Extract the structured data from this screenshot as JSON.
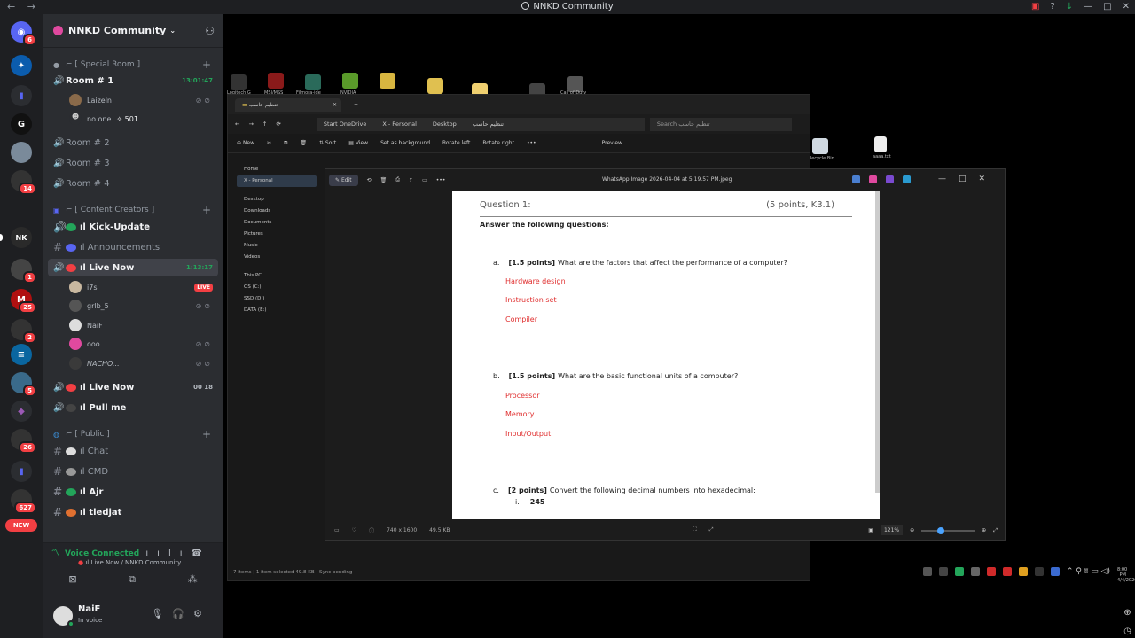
{
  "window": {
    "title": "NNKD Community",
    "nav_back": "←",
    "nav_fwd": "→"
  },
  "server_rail": {
    "items": [
      {
        "name": "discord-home",
        "glyph": "",
        "color": "#5865f2",
        "badge": "6"
      },
      {
        "name": "server-1",
        "glyph": "",
        "color": "#0b5cad",
        "badge": ""
      },
      {
        "name": "server-2",
        "glyph": "",
        "color": "#5865f2",
        "badge": ""
      },
      {
        "name": "server-3",
        "glyph": "G",
        "color": "#111",
        "badge": ""
      },
      {
        "name": "server-4",
        "glyph": "",
        "color": "#7a8a9a",
        "badge": ""
      },
      {
        "name": "server-5",
        "glyph": "",
        "color": "#333",
        "badge": "14"
      },
      {
        "name": "server-6",
        "glyph": "NK",
        "color": "#2a2a2a",
        "badge": ""
      },
      {
        "name": "server-7",
        "glyph": "",
        "color": "#444",
        "badge": "1"
      },
      {
        "name": "server-8",
        "glyph": "M",
        "color": "#b01010",
        "badge": "25"
      },
      {
        "name": "server-9",
        "glyph": "",
        "color": "#333",
        "badge": "2"
      },
      {
        "name": "server-10",
        "glyph": "",
        "color": "#0a66a0",
        "badge": ""
      },
      {
        "name": "server-11",
        "glyph": "",
        "color": "#3a6a8a",
        "badge": "5"
      },
      {
        "name": "server-12",
        "glyph": "",
        "color": "#6a2a8a",
        "badge": ""
      },
      {
        "name": "server-13",
        "glyph": "",
        "color": "#333",
        "badge": "26"
      },
      {
        "name": "server-14",
        "glyph": "",
        "color": "#5865f2",
        "badge": ""
      },
      {
        "name": "server-15",
        "glyph": "",
        "color": "#333",
        "badge": "627"
      },
      {
        "name": "new-badge",
        "glyph": "NEW",
        "color": "#f23f43",
        "badge": ""
      }
    ]
  },
  "guild": {
    "name": "NNKD Community"
  },
  "categories": {
    "special": "Special Room",
    "content": "Content Creators",
    "public": "Public"
  },
  "channels": {
    "room1": {
      "label": "Room # 1",
      "time": "13:01:47"
    },
    "room2": "Room # 2",
    "room3": "Room # 3",
    "room4": "Room # 4",
    "kick_update": "Kick-Update",
    "announcements": "Announcements",
    "live_now": {
      "label": "Live Now",
      "time": "1:13:17"
    },
    "live_now2": {
      "label": "Live Now",
      "count": "00 18"
    },
    "pull_me": "Pull me",
    "chat": "Chat",
    "cmd": "CMD",
    "ajr": "Ajr",
    "tledjat": "tledjat"
  },
  "voice_users": {
    "laizeln": "Laizeln",
    "no_one": {
      "name": "no one",
      "count": "501"
    },
    "i7s": {
      "name": "i7s",
      "badge": "LIVE"
    },
    "grlb5": "grlb_5",
    "naif": "NaiF",
    "ooo": "ooo",
    "nacho": "NACHO..."
  },
  "voice_panel": {
    "status": "Voice Connected",
    "location": "Live Now / NNKD Community"
  },
  "user_panel": {
    "name": "NaiF",
    "status": "In voice"
  },
  "desktop": {
    "icons": [
      "Logitech G",
      "MSI/MSS",
      "Filmora-ide",
      "NVIDIA",
      "",
      "",
      "",
      "",
      "Call of Duty"
    ],
    "right_icons": [
      "Recycle Bin",
      "aaaa.txt"
    ]
  },
  "explorer": {
    "tab": "تنظيم حاسب",
    "breadcrumb": [
      "Start OneDrive",
      "X - Personal",
      "Desktop",
      "تنظيم حاسب"
    ],
    "search_placeholder": "Search تنظيم حاسب",
    "commands": [
      "New",
      "Sort",
      "View",
      "Set as background",
      "Rotate left",
      "Rotate right",
      "Preview"
    ],
    "nav": [
      "Home",
      "X - Personal",
      "Desktop",
      "Downloads",
      "Documents",
      "Pictures",
      "Music",
      "Videos",
      "This PC",
      "OS (C:)",
      "SSD (D:)",
      "DATA (E:)"
    ],
    "status": "7 items  |  1 item selected 49.8 KB  |  Sync pending"
  },
  "viewer": {
    "edit_label": "Edit",
    "filename": "WhatsApp Image 2026-04-04 at 5.19.57 PM.jpeg",
    "dimensions": "740 x 1600",
    "size": "49.5 KB",
    "zoom": "121%"
  },
  "document": {
    "question": "Question 1:",
    "points": "(5 points, K3.1)",
    "instruction": "Answer the following questions:",
    "qa": {
      "prefix": "a.",
      "pts": "[1.5 points]",
      "text": "What are the factors that affect the performance of a computer?",
      "answers": [
        "Hardware design",
        "Instruction set",
        "Compiler"
      ]
    },
    "qb": {
      "prefix": "b.",
      "pts": "[1.5 points]",
      "text": "What are the basic functional units of a computer?",
      "answers": [
        "Processor",
        "Memory",
        "Input/Output"
      ]
    },
    "qc": {
      "prefix": "c.",
      "pts": "[2 points]",
      "text": "Convert the following decimal numbers into hexadecimal:",
      "item_num": "i.",
      "item_val": "245"
    }
  },
  "taskbar": {
    "time": "8:00 PM",
    "date": "4/4/2026"
  }
}
